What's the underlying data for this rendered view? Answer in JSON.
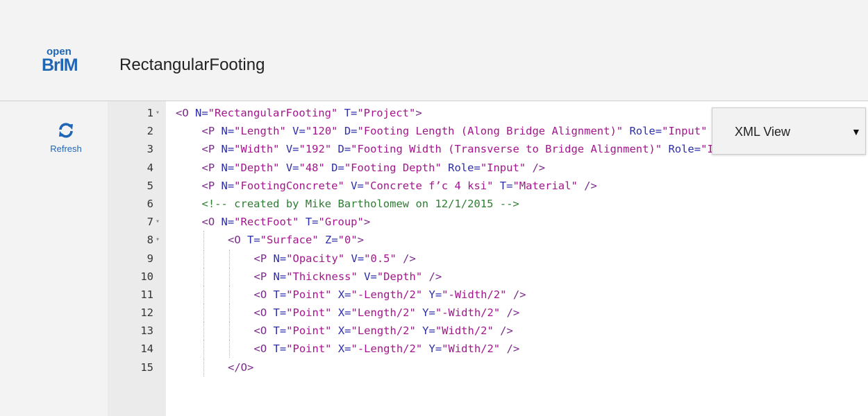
{
  "header": {
    "logo_top": "open",
    "logo_bottom": "BrIM",
    "title": "RectangularFooting"
  },
  "sidebar": {
    "refresh_label": "Refresh",
    "refresh_icon": "refresh-icon"
  },
  "view_selector": {
    "selected": "XML View",
    "caret": "▼"
  },
  "editor": {
    "lines": [
      {
        "num": "1",
        "fold": "▾",
        "indent": 0,
        "tokens": [
          [
            "t",
            "<O "
          ],
          [
            "a",
            "N="
          ],
          [
            "v",
            "\"RectangularFooting\""
          ],
          [
            "a",
            " T="
          ],
          [
            "v",
            "\"Project\""
          ],
          [
            "t",
            ">"
          ]
        ]
      },
      {
        "num": "2",
        "fold": "",
        "indent": 1,
        "tokens": [
          [
            "t",
            "<P "
          ],
          [
            "a",
            "N="
          ],
          [
            "v",
            "\"Length\""
          ],
          [
            "a",
            " V="
          ],
          [
            "v",
            "\"120\""
          ],
          [
            "a",
            " D="
          ],
          [
            "v",
            "\"Footing Length (Along Bridge Alignment)\""
          ],
          [
            "a",
            " Role="
          ],
          [
            "v",
            "\"Input\""
          ],
          [
            "t",
            " />"
          ]
        ]
      },
      {
        "num": "3",
        "fold": "",
        "indent": 1,
        "tokens": [
          [
            "t",
            "<P "
          ],
          [
            "a",
            "N="
          ],
          [
            "v",
            "\"Width\""
          ],
          [
            "a",
            " V="
          ],
          [
            "v",
            "\"192\""
          ],
          [
            "a",
            " D="
          ],
          [
            "v",
            "\"Footing Width (Transverse to Bridge Alignment)\""
          ],
          [
            "a",
            " Role="
          ],
          [
            "v",
            "\"Input\""
          ],
          [
            "t",
            " />"
          ]
        ]
      },
      {
        "num": "4",
        "fold": "",
        "indent": 1,
        "tokens": [
          [
            "t",
            "<P "
          ],
          [
            "a",
            "N="
          ],
          [
            "v",
            "\"Depth\""
          ],
          [
            "a",
            " V="
          ],
          [
            "v",
            "\"48\""
          ],
          [
            "a",
            " D="
          ],
          [
            "v",
            "\"Footing Depth\""
          ],
          [
            "a",
            " Role="
          ],
          [
            "v",
            "\"Input\""
          ],
          [
            "t",
            " />"
          ]
        ]
      },
      {
        "num": "5",
        "fold": "",
        "indent": 1,
        "tokens": [
          [
            "t",
            "<P "
          ],
          [
            "a",
            "N="
          ],
          [
            "v",
            "\"FootingConcrete\""
          ],
          [
            "a",
            " V="
          ],
          [
            "v",
            "\"Concrete f’c 4 ksi\""
          ],
          [
            "a",
            " T="
          ],
          [
            "v",
            "\"Material\""
          ],
          [
            "t",
            " />"
          ]
        ]
      },
      {
        "num": "6",
        "fold": "",
        "indent": 1,
        "tokens": [
          [
            "c",
            "<!-- created by Mike Bartholomew on 12/1/2015 -->"
          ]
        ]
      },
      {
        "num": "7",
        "fold": "▾",
        "indent": 1,
        "tokens": [
          [
            "t",
            "<O "
          ],
          [
            "a",
            "N="
          ],
          [
            "v",
            "\"RectFoot\""
          ],
          [
            "a",
            " T="
          ],
          [
            "v",
            "\"Group\""
          ],
          [
            "t",
            ">"
          ]
        ]
      },
      {
        "num": "8",
        "fold": "▾",
        "indent": 2,
        "tokens": [
          [
            "t",
            "<O "
          ],
          [
            "a",
            "T="
          ],
          [
            "v",
            "\"Surface\""
          ],
          [
            "a",
            " Z="
          ],
          [
            "v",
            "\"0\""
          ],
          [
            "t",
            ">"
          ]
        ]
      },
      {
        "num": "9",
        "fold": "",
        "indent": 3,
        "tokens": [
          [
            "t",
            "<P "
          ],
          [
            "a",
            "N="
          ],
          [
            "v",
            "\"Opacity\""
          ],
          [
            "a",
            " V="
          ],
          [
            "v",
            "\"0.5\""
          ],
          [
            "t",
            " />"
          ]
        ]
      },
      {
        "num": "10",
        "fold": "",
        "indent": 3,
        "tokens": [
          [
            "t",
            "<P "
          ],
          [
            "a",
            "N="
          ],
          [
            "v",
            "\"Thickness\""
          ],
          [
            "a",
            " V="
          ],
          [
            "v",
            "\"Depth\""
          ],
          [
            "t",
            " />"
          ]
        ]
      },
      {
        "num": "11",
        "fold": "",
        "indent": 3,
        "tokens": [
          [
            "t",
            "<O "
          ],
          [
            "a",
            "T="
          ],
          [
            "v",
            "\"Point\""
          ],
          [
            "a",
            " X="
          ],
          [
            "v",
            "\"-Length/2\""
          ],
          [
            "a",
            " Y="
          ],
          [
            "v",
            "\"-Width/2\""
          ],
          [
            "t",
            " />"
          ]
        ]
      },
      {
        "num": "12",
        "fold": "",
        "indent": 3,
        "tokens": [
          [
            "t",
            "<O "
          ],
          [
            "a",
            "T="
          ],
          [
            "v",
            "\"Point\""
          ],
          [
            "a",
            " X="
          ],
          [
            "v",
            "\"Length/2\""
          ],
          [
            "a",
            " Y="
          ],
          [
            "v",
            "\"-Width/2\""
          ],
          [
            "t",
            " />"
          ]
        ]
      },
      {
        "num": "13",
        "fold": "",
        "indent": 3,
        "tokens": [
          [
            "t",
            "<O "
          ],
          [
            "a",
            "T="
          ],
          [
            "v",
            "\"Point\""
          ],
          [
            "a",
            " X="
          ],
          [
            "v",
            "\"Length/2\""
          ],
          [
            "a",
            " Y="
          ],
          [
            "v",
            "\"Width/2\""
          ],
          [
            "t",
            " />"
          ]
        ]
      },
      {
        "num": "14",
        "fold": "",
        "indent": 3,
        "tokens": [
          [
            "t",
            "<O "
          ],
          [
            "a",
            "T="
          ],
          [
            "v",
            "\"Point\""
          ],
          [
            "a",
            " X="
          ],
          [
            "v",
            "\"-Length/2\""
          ],
          [
            "a",
            " Y="
          ],
          [
            "v",
            "\"Width/2\""
          ],
          [
            "t",
            " />"
          ]
        ]
      },
      {
        "num": "15",
        "fold": "",
        "indent": 2,
        "tokens": [
          [
            "t",
            "</O>"
          ]
        ]
      }
    ]
  }
}
